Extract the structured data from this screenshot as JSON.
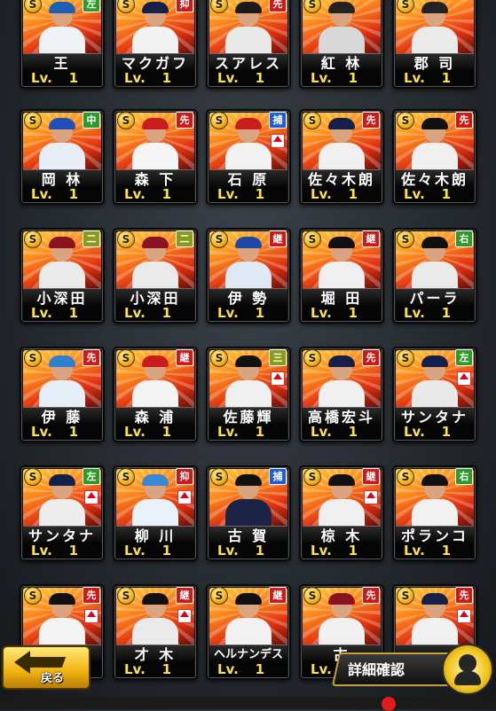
{
  "s_label": "S",
  "lv_label": "Lv.",
  "cards": [
    {
      "name": "王",
      "pos": "左",
      "pos_color": "green",
      "level": "1",
      "cap": "#1e5fb8",
      "shirt": "#eef1f6"
    },
    {
      "name": "マクガフ",
      "pos": "抑",
      "pos_color": "red",
      "level": "1",
      "cap": "#16204a",
      "shirt": "#f2f2f2"
    },
    {
      "name": "スアレス",
      "pos": "先",
      "pos_color": "red",
      "level": "1",
      "cap": "#1a1a1a",
      "shirt": "#e9e9e9"
    },
    {
      "name": "紅 林",
      "pos": "",
      "pos_color": "",
      "level": "1",
      "cap": "#222",
      "shirt": "#d8d8d8"
    },
    {
      "name": "郡 司",
      "pos": "",
      "pos_color": "",
      "level": "1",
      "cap": "#222",
      "shirt": "#eaeaea"
    },
    {
      "name": "岡 林",
      "pos": "中",
      "pos_color": "green",
      "level": "1",
      "cap": "#1f4fb7",
      "shirt": "#e8eef8"
    },
    {
      "name": "森 下",
      "pos": "先",
      "pos_color": "red",
      "level": "1",
      "cap": "#c91d1d",
      "shirt": "#f5f5f5"
    },
    {
      "name": "石 原",
      "pos": "捕",
      "pos_color": "blue",
      "level": "1",
      "cap": "#c91d1d",
      "shirt": "#f2f2f2",
      "up": true
    },
    {
      "name": "佐々木朗",
      "pos": "先",
      "pos_color": "red",
      "level": "1",
      "cap": "#15204a",
      "shirt": "#f0f0f0"
    },
    {
      "name": "佐々木朗",
      "pos": "先",
      "pos_color": "red",
      "level": "1",
      "cap": "#111",
      "shirt": "#f0f0f0"
    },
    {
      "name": "小深田",
      "pos": "二",
      "pos_color": "olive",
      "level": "1",
      "cap": "#8a1221",
      "shirt": "#eaeaea"
    },
    {
      "name": "小深田",
      "pos": "二",
      "pos_color": "olive",
      "level": "1",
      "cap": "#8a1221",
      "shirt": "#eaeaea"
    },
    {
      "name": "伊 勢",
      "pos": "継",
      "pos_color": "red",
      "level": "1",
      "cap": "#1a49a8",
      "shirt": "#dfe9f6"
    },
    {
      "name": "堀 田",
      "pos": "継",
      "pos_color": "red",
      "level": "1",
      "cap": "#111",
      "shirt": "#efefef"
    },
    {
      "name": "パーラ",
      "pos": "右",
      "pos_color": "green",
      "level": "1",
      "cap": "#111",
      "shirt": "#eaeaea"
    },
    {
      "name": "伊 藤",
      "pos": "先",
      "pos_color": "red",
      "level": "1",
      "cap": "#2f7fd0",
      "shirt": "#e6eef8"
    },
    {
      "name": "森 浦",
      "pos": "継",
      "pos_color": "red",
      "level": "1",
      "cap": "#c91d1d",
      "shirt": "#f3f3f3"
    },
    {
      "name": "佐藤輝",
      "pos": "三",
      "pos_color": "olive",
      "level": "1",
      "cap": "#111",
      "shirt": "#efefef",
      "up": true
    },
    {
      "name": "高橋宏斗",
      "pos": "先",
      "pos_color": "red",
      "level": "1",
      "cap": "#15204a",
      "shirt": "#f0f0f0"
    },
    {
      "name": "サンタナ",
      "pos": "左",
      "pos_color": "green",
      "level": "1",
      "cap": "#15204a",
      "shirt": "#e9e9e9",
      "up": true
    },
    {
      "name": "サンタナ",
      "pos": "左",
      "pos_color": "green",
      "level": "1",
      "cap": "#15204a",
      "shirt": "#ededed",
      "up": true
    },
    {
      "name": "柳 川",
      "pos": "抑",
      "pos_color": "red",
      "level": "1",
      "cap": "#3a88d4",
      "shirt": "#e9f2fb",
      "up": true
    },
    {
      "name": "古 賀",
      "pos": "捕",
      "pos_color": "blue",
      "level": "1",
      "cap": "#111",
      "shirt": "#1b2347"
    },
    {
      "name": "椋 木",
      "pos": "継",
      "pos_color": "red",
      "level": "1",
      "cap": "#111",
      "shirt": "#efefef",
      "up": true
    },
    {
      "name": "ポランコ",
      "pos": "右",
      "pos_color": "green",
      "level": "1",
      "cap": "#111",
      "shirt": "#f1f1f1"
    },
    {
      "name": "",
      "pos": "先",
      "pos_color": "red",
      "level": "",
      "cap": "#111",
      "shirt": "#f3f3f3",
      "up": true
    },
    {
      "name": "才 木",
      "pos": "継",
      "pos_color": "red",
      "level": "1",
      "cap": "#111",
      "shirt": "#eaeaea",
      "up": true
    },
    {
      "name": "ヘルナンデス",
      "pos": "継",
      "pos_color": "red",
      "level": "1",
      "cap": "#111",
      "shirt": "#f1f1f1"
    },
    {
      "name": "古",
      "pos": "先",
      "pos_color": "red",
      "level": "1",
      "cap": "#8a1221",
      "shirt": "#f0f0f0"
    },
    {
      "name": "",
      "pos": "先",
      "pos_color": "red",
      "level": "",
      "cap": "#15204a",
      "shirt": "#f0f0f0",
      "up": true
    }
  ],
  "back_button": {
    "label": "戻る"
  },
  "detail_button": {
    "label": "詳細確認",
    "icon": "person-icon"
  }
}
